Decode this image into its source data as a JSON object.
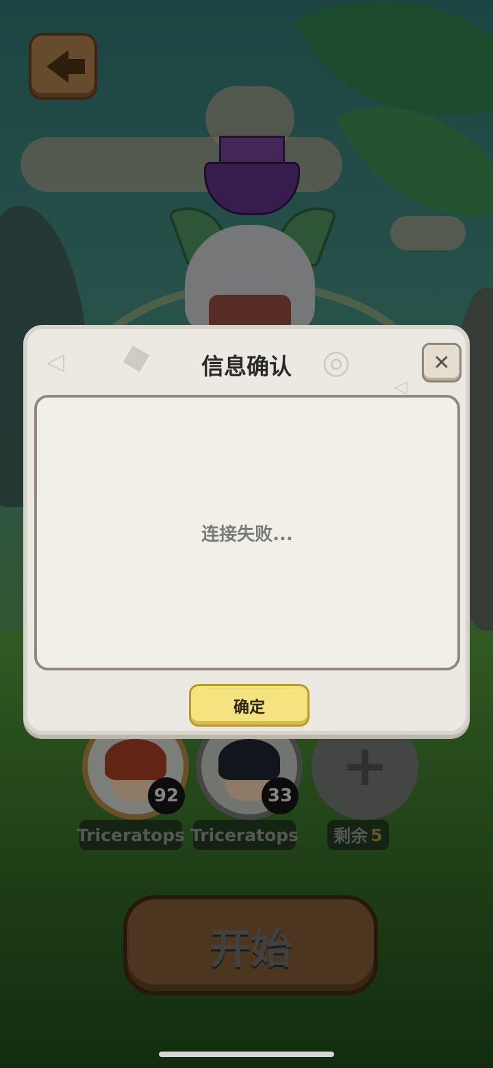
{
  "game": {
    "back_icon": "back-arrow-icon",
    "squad": [
      {
        "name": "Triceratops",
        "level": "92"
      },
      {
        "name": "Triceratops",
        "level": "33"
      }
    ],
    "add_slot_icon": "plus-icon",
    "remaining_label": "剩余",
    "remaining_count": "5",
    "start_label": "开始"
  },
  "dialog": {
    "title": "信息确认",
    "close_icon": "close-icon",
    "close_glyph": "✕",
    "message": "连接失败...",
    "confirm_label": "确定"
  },
  "colors": {
    "dialog_bg": "#ece9e2",
    "confirm_bg": "#f5e37f",
    "start_bg": "#7c5833"
  }
}
